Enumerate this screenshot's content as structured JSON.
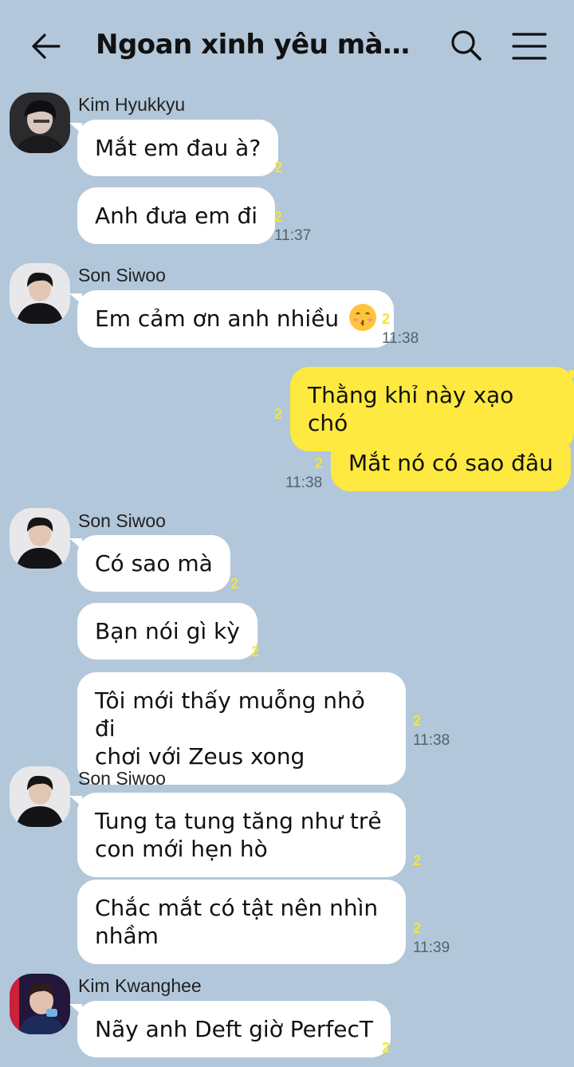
{
  "header": {
    "title": "Ngoan xinh yêu mà bị t...",
    "back_icon": "arrow-left-icon",
    "search_icon": "search-icon",
    "menu_icon": "hamburger-menu-icon"
  },
  "colors": {
    "background": "#b2c7da",
    "incoming_bubble": "#ffffff",
    "outgoing_bubble": "#fde93f",
    "unread_count": "#f4e438"
  },
  "messages": [
    {
      "sender": "Kim Hyukkyu",
      "text": "Mắt em đau à?",
      "unread": "2"
    },
    {
      "text": "Anh đưa em đi",
      "unread": "2",
      "time": "11:37"
    },
    {
      "sender": "Son Siwoo",
      "text": "Em cảm ơn anh nhiều",
      "emoji": "kissing-face-emoji",
      "unread": "2",
      "time": "11:38"
    },
    {
      "self": true,
      "text": "Thằng khỉ này xạo chó",
      "unread": "2"
    },
    {
      "self": true,
      "text": "Mắt nó có sao đâu",
      "unread": "2",
      "time": "11:38"
    },
    {
      "sender": "Son Siwoo",
      "text": "Có sao mà",
      "unread": "2"
    },
    {
      "text": "Bạn nói gì kỳ",
      "unread": "2"
    },
    {
      "text_line1": "Tôi mới thấy muỗng nhỏ đi",
      "text_line2": "chơi với Zeus xong",
      "unread": "2",
      "time": "11:38"
    },
    {
      "sender": "Son Siwoo",
      "text_line1": "Tung ta tung tăng như trẻ",
      "text_line2": "con mới hẹn hò",
      "unread": "2"
    },
    {
      "text_line1": "Chắc mắt có tật nên nhìn",
      "text_line2": "nhầm",
      "unread": "2",
      "time": "11:39"
    },
    {
      "sender": "Kim Kwanghee",
      "text": "Nãy anh Deft giờ PerfecT",
      "unread": "2"
    }
  ]
}
